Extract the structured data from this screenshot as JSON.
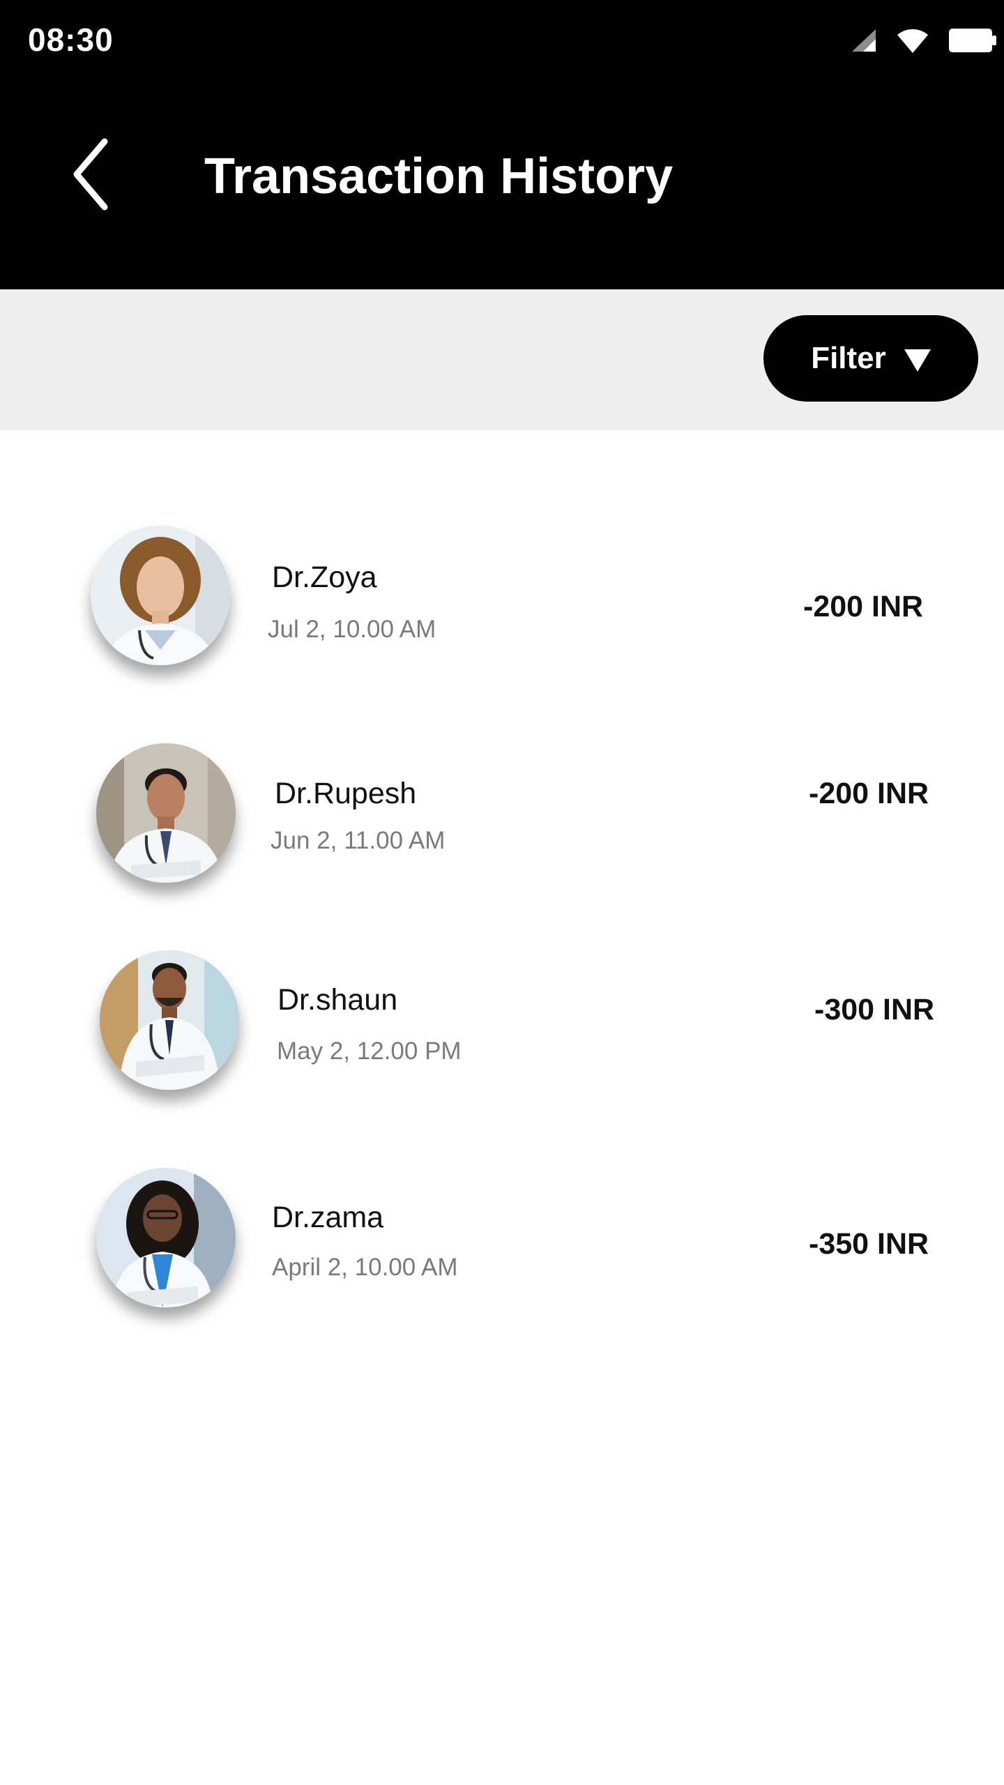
{
  "status_bar": {
    "time": "08:30",
    "icons": [
      "signal-icon",
      "wifi-icon",
      "battery-icon"
    ]
  },
  "app_bar": {
    "back_icon": "chevron-left-icon",
    "title": "Transaction History"
  },
  "filter": {
    "label": "Filter",
    "icon": "caret-down-icon"
  },
  "transactions": [
    {
      "name": "Dr.Zoya",
      "date": "Jul 2, 10.00 AM",
      "amount": "-200 INR"
    },
    {
      "name": "Dr.Rupesh",
      "date": "Jun 2, 11.00 AM",
      "amount": "-200 INR"
    },
    {
      "name": "Dr.shaun",
      "date": "May 2, 12.00 PM",
      "amount": "-300 INR"
    },
    {
      "name": "Dr.zama",
      "date": "April 2, 10.00 AM",
      "amount": "-350 INR"
    }
  ],
  "colors": {
    "app_bar": "#000000",
    "filter_bar": "#eeeeee",
    "filter_button": "#000000",
    "date_text": "#7a7a7a"
  }
}
